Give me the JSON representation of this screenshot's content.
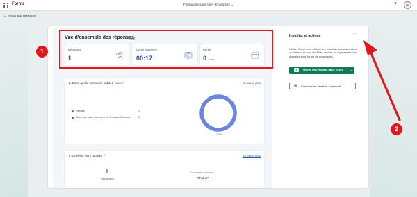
{
  "header": {
    "app_name": "Forms",
    "doc_title": "Formulaire sans titre - Enregistré ⌄",
    "help_icon": "help-icon",
    "help_glyph": "?",
    "avatar_initials": "ML"
  },
  "nav": {
    "back_label": "← Retour aux questions"
  },
  "overview": {
    "title": "Vue d'ensemble des réponses",
    "status": "Actif",
    "stats": [
      {
        "label": "Réponses",
        "value": "1",
        "unit": "",
        "icon": "responses-icon"
      },
      {
        "label": "Durée moyenne",
        "value": "00:17",
        "unit": "",
        "icon": "clock-icon"
      },
      {
        "label": "Durée",
        "value": "0",
        "unit": "Jours",
        "icon": "calendar-icon"
      }
    ]
  },
  "questions": [
    {
      "title": "1. Dans quelle commune habitez-vous ?",
      "link": "En savoir plus",
      "chart_type": "donut",
      "options": [
        {
          "label": "Rennes",
          "count": "1",
          "color": "#4c73d3"
        },
        {
          "label": "Dans une autre commune de Rennes Métropole",
          "count": "0",
          "color": "#d4158c"
        }
      ],
      "percent_label": "100%"
    },
    {
      "title": "2. Quel est votre quartier ?",
      "link": "En savoir plus",
      "responses_count": "1",
      "responses_label": "Réponses",
      "latest_label": "Dernières réponses",
      "latest_value": "\"Thabor\""
    }
  ],
  "insights": {
    "title": "Insights et actions",
    "more_glyph": "···",
    "description": "Utiliser Excel pour afficher les résultats actualisés dans un tableau et pour les filtrer, revisar ou représenter vos données sous forme de graphiques.",
    "excel_button": "Ouvrir les résultats dans Excel",
    "excel_caret": "⌄",
    "individual_button": "Consulter les résultats individuels"
  },
  "annotations": {
    "badge1": "1",
    "badge2": "2",
    "accent": "#e4161b"
  },
  "colors": {
    "brand": "#0f7b55",
    "value_blue": "#2c4ca6",
    "donut": "#6b86dc"
  }
}
